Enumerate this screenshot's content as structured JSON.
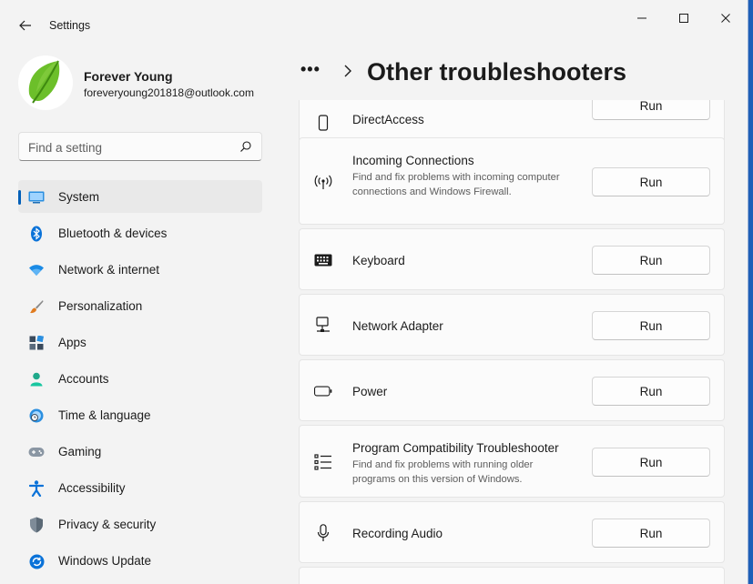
{
  "window": {
    "title": "Settings"
  },
  "profile": {
    "name": "Forever Young",
    "email": "foreveryoung201818@outlook.com"
  },
  "search": {
    "placeholder": "Find a setting"
  },
  "nav": {
    "items": [
      {
        "label": "System",
        "icon": "monitor-icon",
        "active": true
      },
      {
        "label": "Bluetooth & devices",
        "icon": "bluetooth-icon"
      },
      {
        "label": "Network & internet",
        "icon": "wifi-icon"
      },
      {
        "label": "Personalization",
        "icon": "paintbrush-icon"
      },
      {
        "label": "Apps",
        "icon": "apps-icon"
      },
      {
        "label": "Accounts",
        "icon": "person-icon"
      },
      {
        "label": "Time & language",
        "icon": "globe-clock-icon"
      },
      {
        "label": "Gaming",
        "icon": "gamepad-icon"
      },
      {
        "label": "Accessibility",
        "icon": "accessibility-icon"
      },
      {
        "label": "Privacy & security",
        "icon": "shield-icon"
      },
      {
        "label": "Windows Update",
        "icon": "update-icon"
      }
    ]
  },
  "breadcrumb": {
    "more": "•••",
    "title": "Other troubleshooters"
  },
  "troubleshooters": [
    {
      "title": "DirectAccess",
      "desc": "",
      "icon": "phone-icon",
      "button": "Run"
    },
    {
      "title": "Incoming Connections",
      "desc": "Find and fix problems with incoming computer connections and Windows Firewall.",
      "icon": "antenna-icon",
      "button": "Run"
    },
    {
      "title": "Keyboard",
      "desc": "",
      "icon": "keyboard-icon",
      "button": "Run"
    },
    {
      "title": "Network Adapter",
      "desc": "",
      "icon": "network-adapter-icon",
      "button": "Run"
    },
    {
      "title": "Power",
      "desc": "",
      "icon": "battery-icon",
      "button": "Run"
    },
    {
      "title": "Program Compatibility Troubleshooter",
      "desc": "Find and fix problems with running older programs on this version of Windows.",
      "icon": "list-icon",
      "button": "Run"
    },
    {
      "title": "Recording Audio",
      "desc": "",
      "icon": "microphone-icon",
      "button": "Run"
    }
  ],
  "colors": {
    "accent": "#005fb8",
    "background": "#f3f3f3",
    "card": "#fbfbfb"
  }
}
